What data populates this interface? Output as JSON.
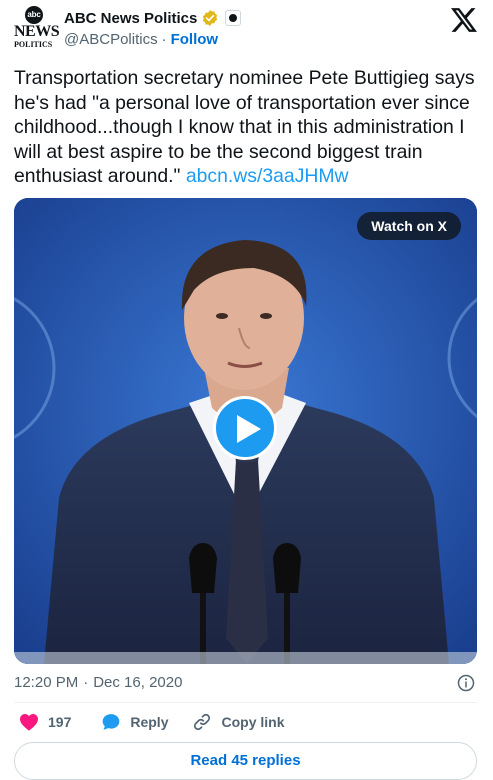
{
  "account": {
    "avatar_logo": "abc",
    "avatar_line1": "NEWS",
    "avatar_line2": "POLITICS",
    "display_name": "ABC News Politics",
    "handle": "@ABCPolitics",
    "separator": "·",
    "follow_label": "Follow",
    "verified_badge": "gold-check-icon",
    "affiliate_badge": "abc-affiliate-icon"
  },
  "platform_icon": "x-logo-icon",
  "tweet": {
    "text": "Transportation secretary nominee Pete Buttigieg says he's had \"a personal love of transportation ever since childhood...though I know that in this administration I will at best aspire to be the second biggest train enthusiast around.\" ",
    "link_text": "abcn.ws/3aaJHMw"
  },
  "media": {
    "watch_label": "Watch on X",
    "play_icon": "play-icon"
  },
  "meta": {
    "time": "12:20 PM",
    "separator": "·",
    "date": "Dec 16, 2020"
  },
  "actions": {
    "like_count": "197",
    "reply_label": "Reply",
    "copy_label": "Copy link"
  },
  "read_replies_label": "Read 45 replies",
  "colors": {
    "accent": "#1d9bf0",
    "link": "#006fd6",
    "like": "#f91880",
    "verified_gold": "#e2b719",
    "stage_blue": "#1f4ea6"
  }
}
